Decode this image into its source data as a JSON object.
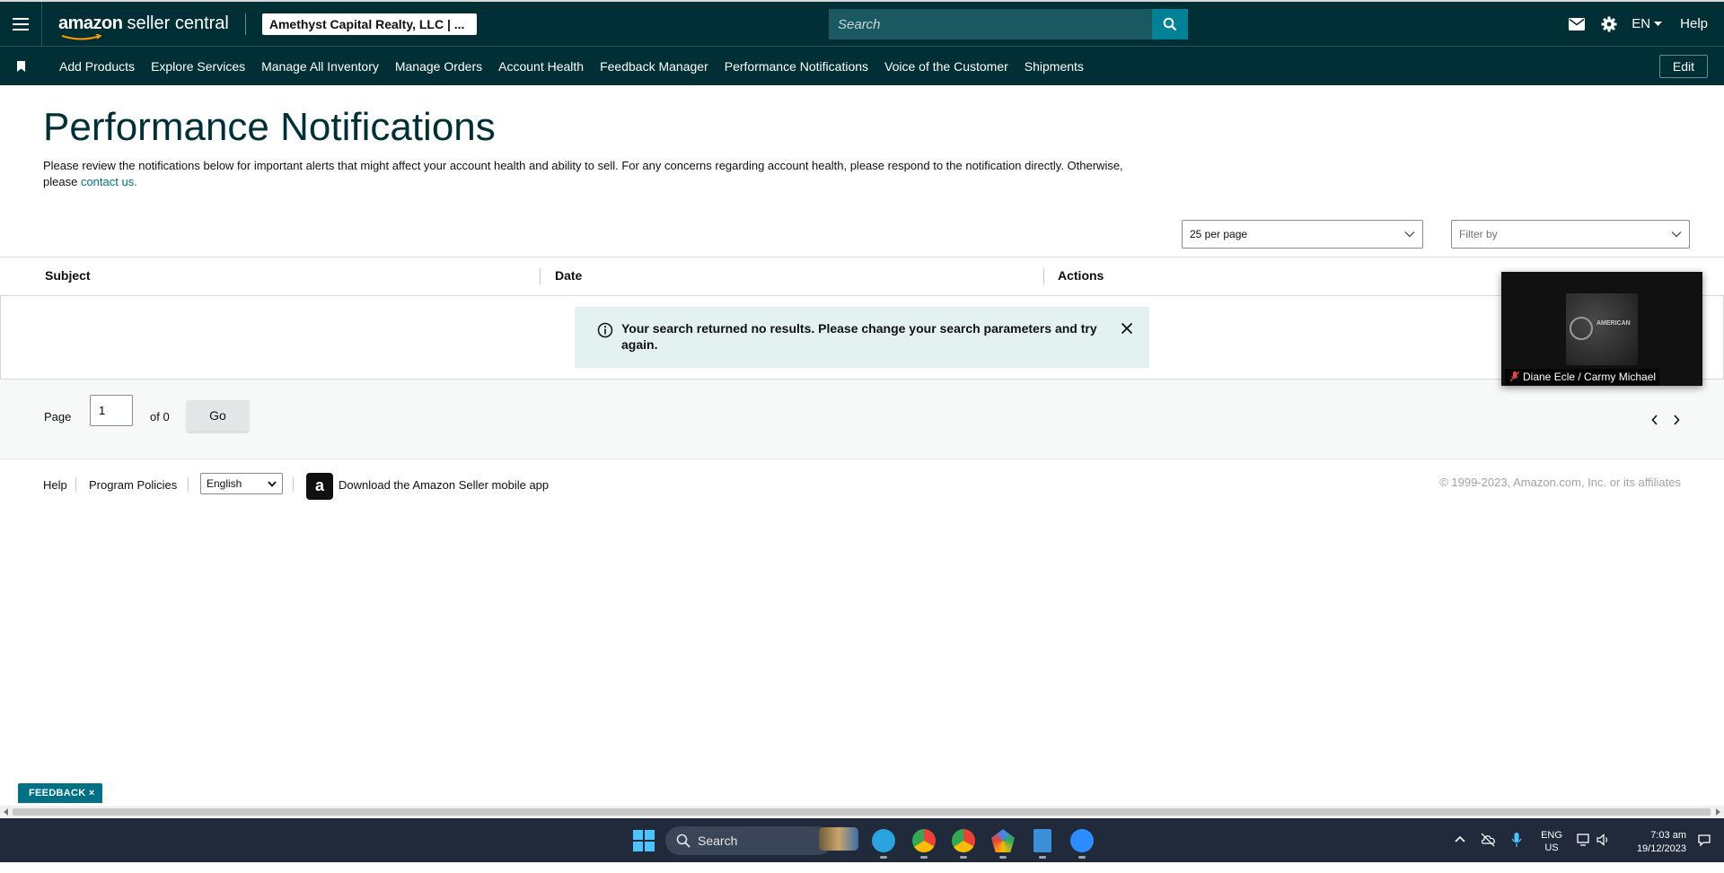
{
  "topbar": {
    "logo_word1": "amazon",
    "logo_word2": "seller central",
    "account_name": "Amethyst Capital Realty, LLC | ...",
    "search_placeholder": "Search",
    "language": "EN",
    "help": "Help"
  },
  "nav": {
    "items": [
      {
        "label": "Add Products"
      },
      {
        "label": "Explore Services"
      },
      {
        "label": "Manage All Inventory"
      },
      {
        "label": "Manage Orders"
      },
      {
        "label": "Account Health"
      },
      {
        "label": "Feedback Manager"
      },
      {
        "label": "Performance Notifications"
      },
      {
        "label": "Voice of the Customer"
      },
      {
        "label": "Shipments"
      }
    ],
    "edit_label": "Edit"
  },
  "page": {
    "title": "Performance Notifications",
    "description": "Please review the notifications below for important alerts that might affect your account health and ability to sell. For any concerns regarding account health, please respond to the notification directly. Otherwise, please",
    "contact_link": "contact us.",
    "per_page": "25 per page",
    "filter_placeholder": "Filter by"
  },
  "table": {
    "columns": [
      "Subject",
      "Date",
      "Actions"
    ],
    "empty_message": "Your search returned no results. Please change your search parameters and try again."
  },
  "pagination": {
    "page_label": "Page",
    "current_page": "1",
    "of_label": "of 0",
    "go_label": "Go"
  },
  "footer": {
    "help": "Help",
    "program_policies": "Program Policies",
    "language": "English",
    "app_icon_letter": "a",
    "download_app": "Download the Amazon Seller mobile app",
    "copyright": "© 1999-2023, Amazon.com, Inc. or its affiliates"
  },
  "video_overlay": {
    "participant_name": "Diane Ecle / Carmy Michael",
    "thumbnail_text": "AMERICAN"
  },
  "feedback": {
    "label": "FEEDBACK",
    "close": "×"
  },
  "taskbar": {
    "search_label": "Search",
    "lang_line1": "ENG",
    "lang_line2": "US",
    "time": "7:03 am",
    "date": "19/12/2023"
  },
  "colors": {
    "header_bg": "#002f36",
    "accent": "#008296",
    "link": "#007185",
    "alert_bg": "#e3f1f1"
  }
}
